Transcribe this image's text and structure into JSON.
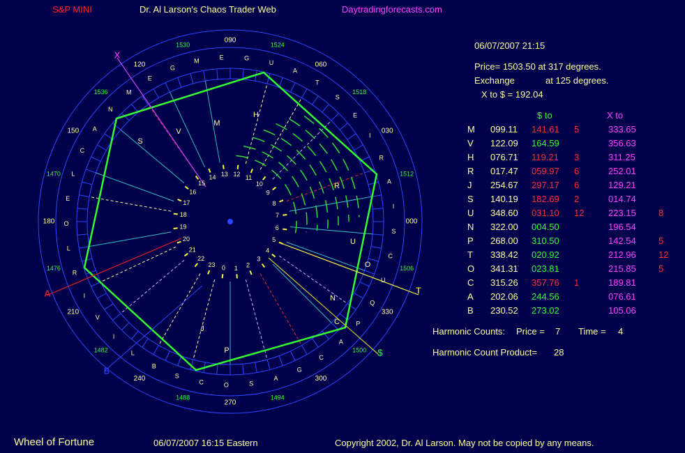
{
  "header": {
    "symbol": "S&P MINI",
    "title": "Dr. Al Larson's Chaos Trader Web",
    "site": "Daytradingforecasts.com"
  },
  "info": {
    "datetime": "06/07/2007 21:15",
    "price_line": "Price= 1503.50 at 317 degrees.",
    "exchange_label": "Exchange",
    "exchange_value": "at 125 degrees.",
    "x_to_dollar": "X to $  = 192.04"
  },
  "table": {
    "col_dollar": "$ to",
    "col_x": "X to",
    "rows": [
      {
        "sym": "M",
        "deg": "099.11",
        "dto": "141.61",
        "dc": "5",
        "xto": "333.65",
        "xc": ""
      },
      {
        "sym": "V",
        "deg": "122.09",
        "dto": "164.59",
        "dc": "",
        "xto": "356.63",
        "xc": ""
      },
      {
        "sym": "H",
        "deg": "076.71",
        "dto": "119.21",
        "dc": "3",
        "xto": "311.25",
        "xc": ""
      },
      {
        "sym": "R",
        "deg": "017.47",
        "dto": "059.97",
        "dc": "6",
        "xto": "252.01",
        "xc": ""
      },
      {
        "sym": "J",
        "deg": "254.67",
        "dto": "297.17",
        "dc": "6",
        "xto": "129.21",
        "xc": ""
      },
      {
        "sym": "S",
        "deg": "140.19",
        "dto": "182.69",
        "dc": "2",
        "xto": "014.74",
        "xc": ""
      },
      {
        "sym": "U",
        "deg": "348.60",
        "dto": "031.10",
        "dc": "12",
        "xto": "223.15",
        "xc": "8"
      },
      {
        "sym": "N",
        "deg": "322.00",
        "dto": "004.50",
        "dc": "",
        "xto": "196.54",
        "xc": ""
      },
      {
        "sym": "P",
        "deg": "268.00",
        "dto": "310.50",
        "dc": "",
        "xto": "142.54",
        "xc": "5"
      },
      {
        "sym": "T",
        "deg": "338.42",
        "dto": "020.92",
        "dc": "",
        "xto": "212.96",
        "xc": "12"
      },
      {
        "sym": "O",
        "deg": "341.31",
        "dto": "023.81",
        "dc": "",
        "xto": "215.85",
        "xc": "5"
      },
      {
        "sym": "C",
        "deg": "315.26",
        "dto": "357.76",
        "dc": "1",
        "xto": "189.81",
        "xc": ""
      },
      {
        "sym": "A",
        "deg": "202.06",
        "dto": "244.56",
        "dc": "",
        "xto": "076.61",
        "xc": ""
      },
      {
        "sym": "B",
        "deg": "230.52",
        "dto": "273.02",
        "dc": "",
        "xto": "105.06",
        "xc": ""
      }
    ]
  },
  "harmonic": {
    "label": "Harmonic Counts:",
    "price_label": "Price =",
    "price_value": "7",
    "time_label": "Time =",
    "time_value": "4",
    "product_label": "Harmonic Count Product=",
    "product_value": "28"
  },
  "footer": {
    "name": "Wheel of Fortune",
    "time": "06/07/2007 16:15 Eastern",
    "copyright": "Copyright 2002, Dr. Al Larson. May not be copied by any means."
  },
  "wheel": {
    "degree_labels": [
      "000",
      "030",
      "060",
      "090",
      "120",
      "150",
      "180",
      "210",
      "240",
      "270",
      "300",
      "330"
    ],
    "price_labels": [
      "1512",
      "1518",
      "1524",
      "1530",
      "1536",
      "1470",
      "1476",
      "1482",
      "1488",
      "1494",
      "1500",
      "1506"
    ],
    "hours": [
      "0",
      "1",
      "2",
      "3",
      "4",
      "5",
      "6",
      "7",
      "8",
      "9",
      "10",
      "11",
      "12",
      "13",
      "14",
      "15",
      "16",
      "17",
      "18",
      "19",
      "20",
      "21",
      "22",
      "23"
    ],
    "outer_letters": [
      "A",
      "R",
      "I",
      "E",
      "S",
      "T",
      "A",
      "U",
      "G",
      "E",
      "M",
      "G",
      "E",
      "M",
      "N",
      "A",
      "C",
      "L",
      "E",
      "O",
      "L",
      "R",
      "I",
      "V",
      "I",
      "L",
      "B",
      "S",
      "C",
      "O",
      "S",
      "A",
      "G",
      "C",
      "A",
      "P",
      "Q",
      "U",
      "C",
      "S",
      "I"
    ],
    "planet_marks": [
      "X",
      "A",
      "T",
      "$",
      "M",
      "V",
      "H",
      "S",
      "R",
      "J",
      "U",
      "N",
      "P",
      "O",
      "C",
      "B"
    ],
    "colors": {
      "background": "#00004a",
      "ring": "#3050ff",
      "green_label": "#33ff33",
      "polygon": "#33ff33",
      "yellow_text": "#ffffa0",
      "red": "#ff3030",
      "magenta": "#ff40ff"
    }
  }
}
